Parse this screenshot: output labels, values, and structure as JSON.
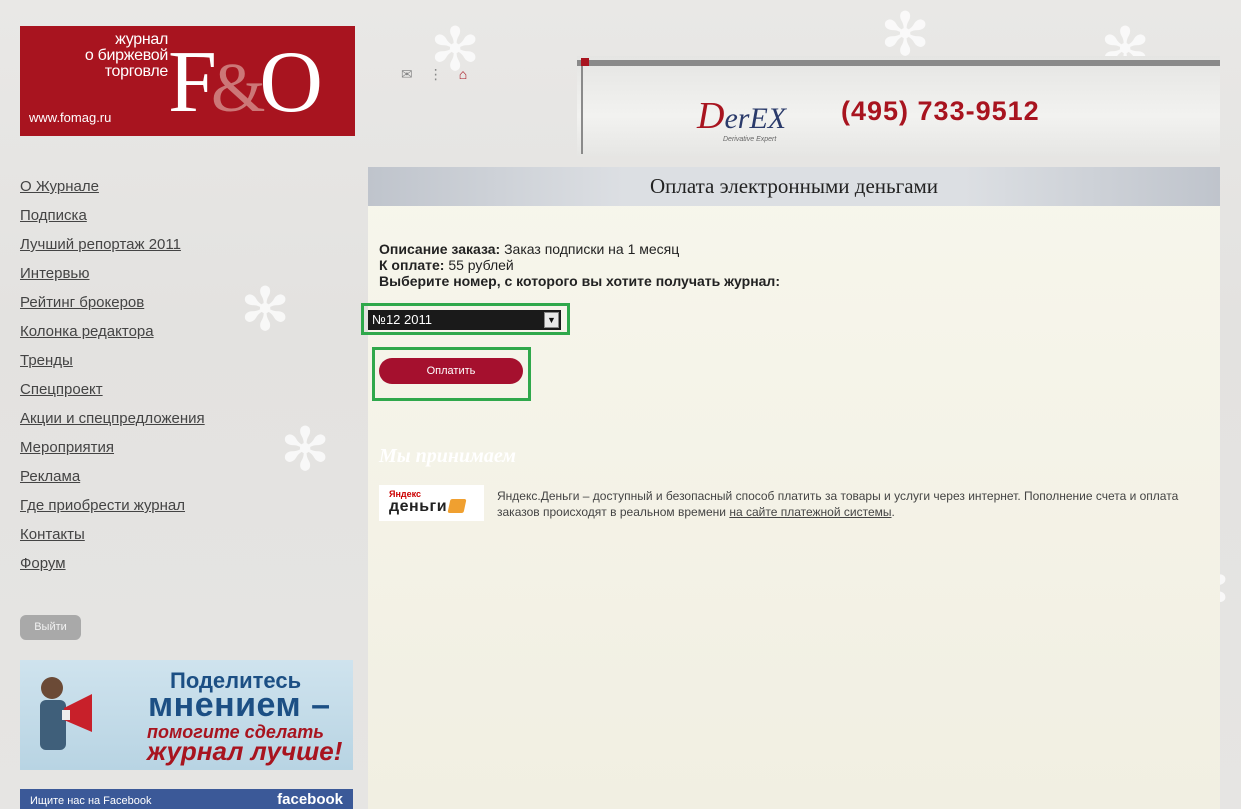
{
  "logo": {
    "text_lines": [
      "журнал",
      "о биржевой",
      "торговле"
    ],
    "url": "www.fomag.ru",
    "brand_f": "F",
    "brand_amp": "&",
    "brand_o": "O"
  },
  "top_icons": [
    "mail-icon",
    "sitemap-icon",
    "home-icon"
  ],
  "banner": {
    "brand_d": "D",
    "brand_rest": "erEX",
    "brand_sub": "Derivative Expert",
    "phone": "(495) 733-9512"
  },
  "sidebar": {
    "items": [
      {
        "label": "О Журнале"
      },
      {
        "label": "Подписка"
      },
      {
        "label": "Лучший репортаж 2011"
      },
      {
        "label": "Интервью"
      },
      {
        "label": "Рейтинг брокеров"
      },
      {
        "label": "Колонка редактора"
      },
      {
        "label": "Тренды"
      },
      {
        "label": "Спецпроект"
      },
      {
        "label": "Акции и спецпредложения"
      },
      {
        "label": "Мероприятия"
      },
      {
        "label": "Реклама"
      },
      {
        "label": "Где приобрести журнал"
      },
      {
        "label": "Контакты"
      },
      {
        "label": "Форум"
      }
    ],
    "logout_label": "Выйти"
  },
  "promo": {
    "line1": "Поделитесь",
    "line2": "мнением –",
    "line3": "помогите сделать",
    "line4": "журнал лучше!"
  },
  "facebook": {
    "text": "Ищите нас на Facebook",
    "brand": "facebook"
  },
  "main": {
    "header": "Оплата электронными деньгами",
    "order_label": "Описание заказа:",
    "order_value": "Заказ подписки на 1 месяц",
    "amount_label": "К оплате:",
    "amount_value": "55 рублей",
    "choose_label": "Выберите номер, с которого вы хотите получать журнал:",
    "issue_select": "№12 2011",
    "pay_button": "Оплатить",
    "accept_title": "Мы принимаем",
    "ym_yandex": "Яндекс",
    "ym_money": "деньги",
    "ym_desc": "Яндекс.Деньги – доступный и безопасный способ платить за товары и услуги через интернет. Пополнение счета и оплата заказов происходят в реальном времени",
    "ym_link": "на сайте платежной системы",
    "ym_dot": "."
  }
}
